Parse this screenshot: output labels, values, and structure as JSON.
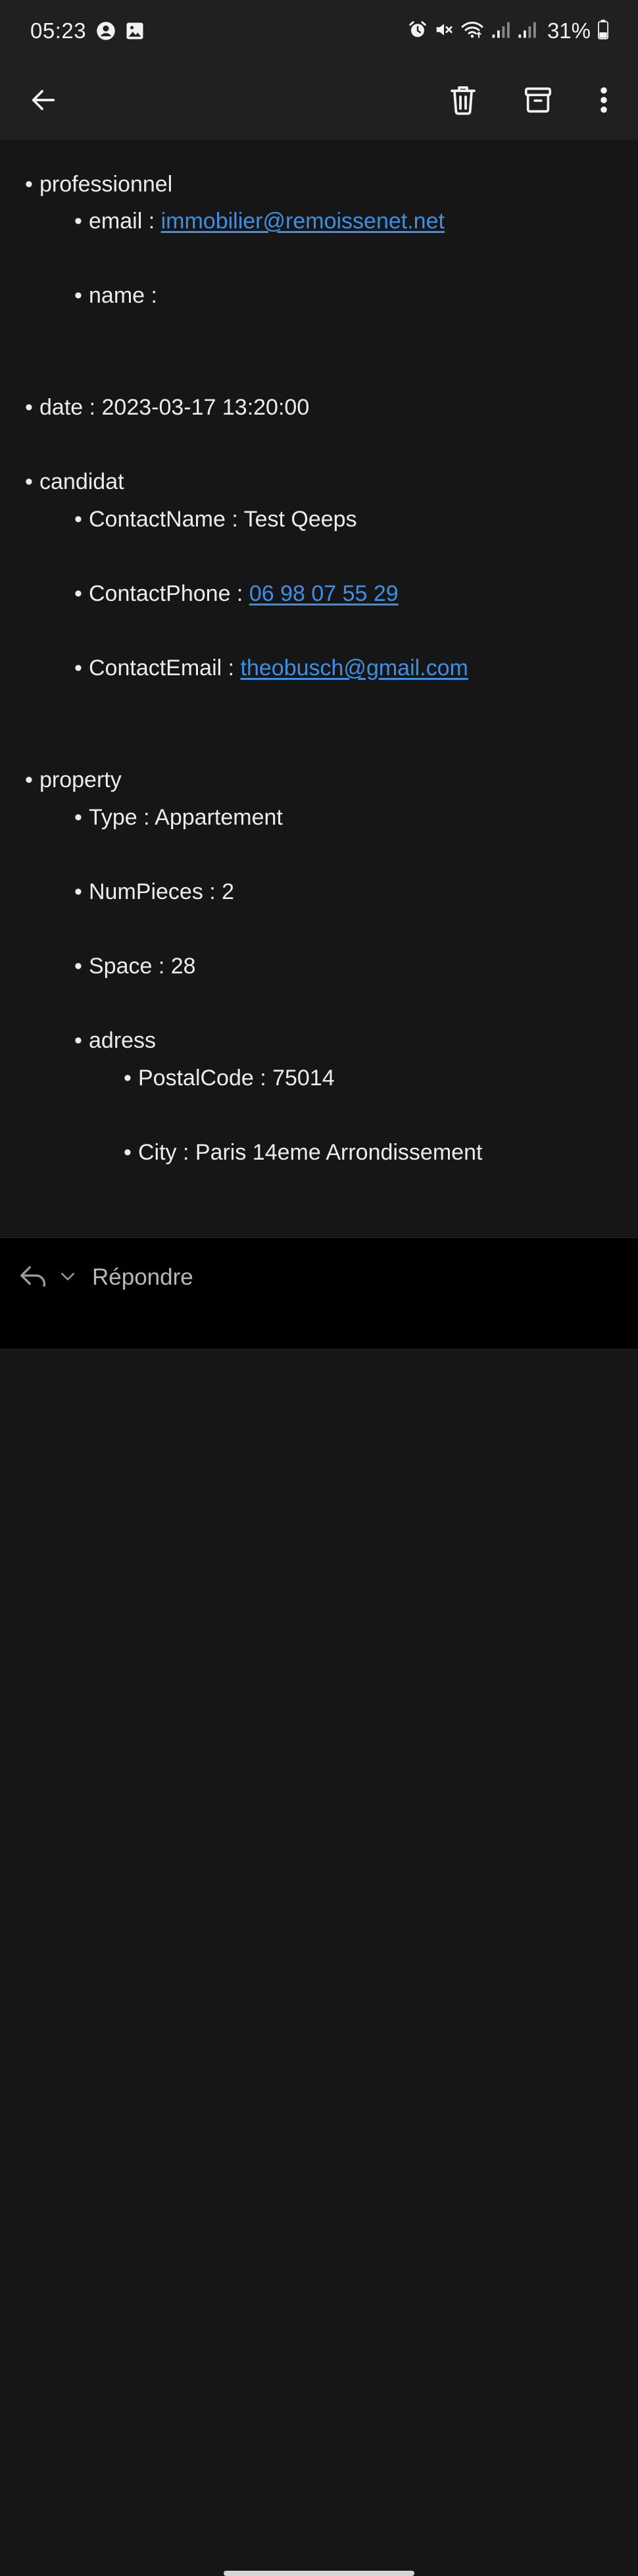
{
  "status_bar": {
    "time": "05:23",
    "battery": "31%",
    "left_icons": [
      "account-circle-icon",
      "image-icon"
    ],
    "right_icons": [
      "alarm-icon",
      "mute-icon",
      "wifi-icon",
      "signal-icon",
      "signal-icon",
      "battery-icon"
    ]
  },
  "toolbar": {
    "icons": [
      "back-arrow-icon",
      "trash-icon",
      "archive-icon",
      "more-vert-icon"
    ]
  },
  "email_body": {
    "professionnel_label": "professionnel",
    "email_label": "email : ",
    "email_value": "immobilier@remoissenet.net",
    "name_label": "name :",
    "date_line": "date : 2023-03-17 13:20:00",
    "candidat_label": "candidat",
    "contact_name_line": "ContactName : Test Qeeps",
    "contact_phone_label": "ContactPhone : ",
    "contact_phone_value": "06 98 07 55 29",
    "contact_email_label": "ContactEmail : ",
    "contact_email_value": "theobusch@gmail.com",
    "property_label": "property",
    "type_line": "Type : Appartement",
    "numpieces_line": "NumPieces : 2",
    "space_line": "Space : 28",
    "adress_label": "adress",
    "postalcode_line": "PostalCode : 75014",
    "city_line": "City : Paris 14eme Arrondissement"
  },
  "reply_bar": {
    "reply_label": "Répondre"
  },
  "colors": {
    "background": "#161616",
    "bar": "#202020",
    "link": "#3d8fe6",
    "text": "#ececec"
  }
}
